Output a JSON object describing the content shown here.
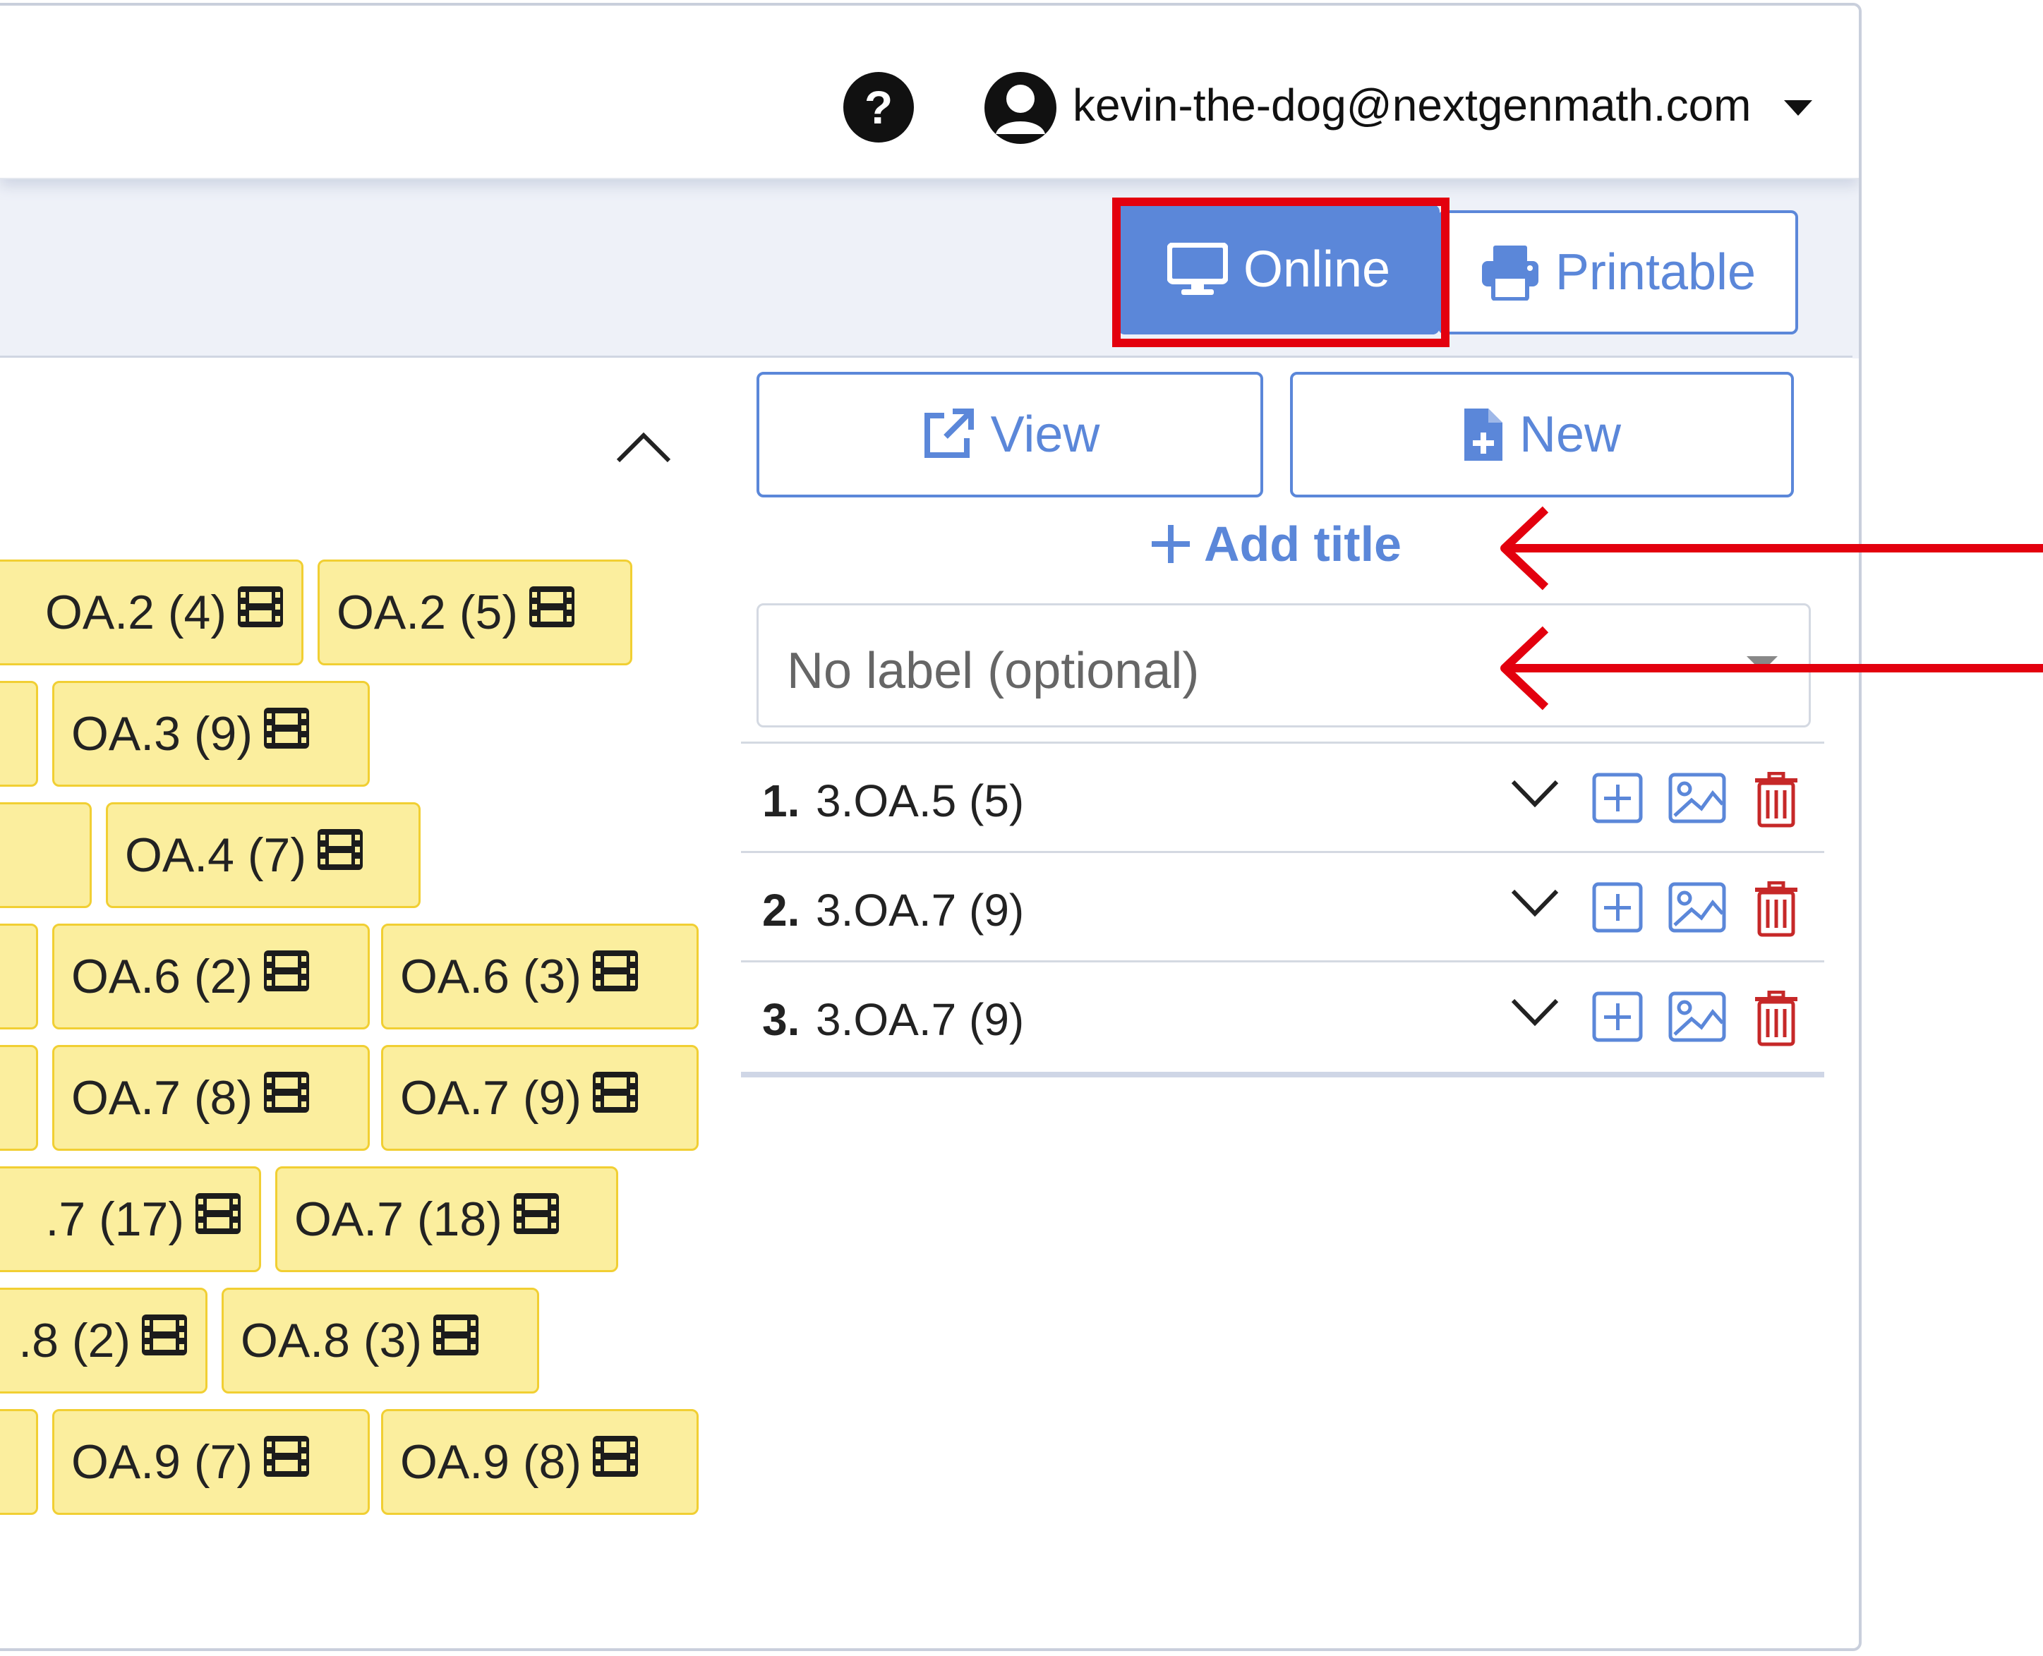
{
  "header": {
    "help_icon": "question-circle-icon",
    "user_icon": "user-circle-icon",
    "user_email": "kevin-the-dog@nextgenmath.com",
    "help_glyph": "?"
  },
  "mode_toggle": {
    "online_label": "Online",
    "printable_label": "Printable",
    "online_icon": "desktop-icon",
    "printable_icon": "printer-icon",
    "selected": "Online"
  },
  "left_panel": {
    "collapse_icon": "chevron-up-icon",
    "chip_icon": "film-icon",
    "chips": [
      {
        "label": "OA.2 (4)"
      },
      {
        "label": "OA.2 (5)"
      },
      {
        "label": "OA.3 (9)"
      },
      {
        "label": "OA.4 (7)"
      },
      {
        "label": "OA.6 (2)"
      },
      {
        "label": "OA.6 (3)"
      },
      {
        "label": "OA.7 (8)"
      },
      {
        "label": "OA.7 (9)"
      },
      {
        "label": ".7 (17)"
      },
      {
        "label": "OA.7 (18)"
      },
      {
        "label": ".8 (2)"
      },
      {
        "label": "OA.8 (3)"
      },
      {
        "label": "OA.9 (7)"
      },
      {
        "label": "OA.9 (8)"
      }
    ]
  },
  "right_panel": {
    "view_label": "View",
    "new_label": "New",
    "add_title_label": "Add title",
    "label_placeholder": "No label (optional)",
    "questions": [
      {
        "number": "1.",
        "text": "3.OA.5 (5)"
      },
      {
        "number": "2.",
        "text": "3.OA.7 (9)"
      },
      {
        "number": "3.",
        "text": "3.OA.7 (9)"
      }
    ]
  },
  "annotations": {
    "highlight_color": "#e3000e",
    "accent_color": "#5b87d9",
    "chip_color": "#fbee9e"
  }
}
